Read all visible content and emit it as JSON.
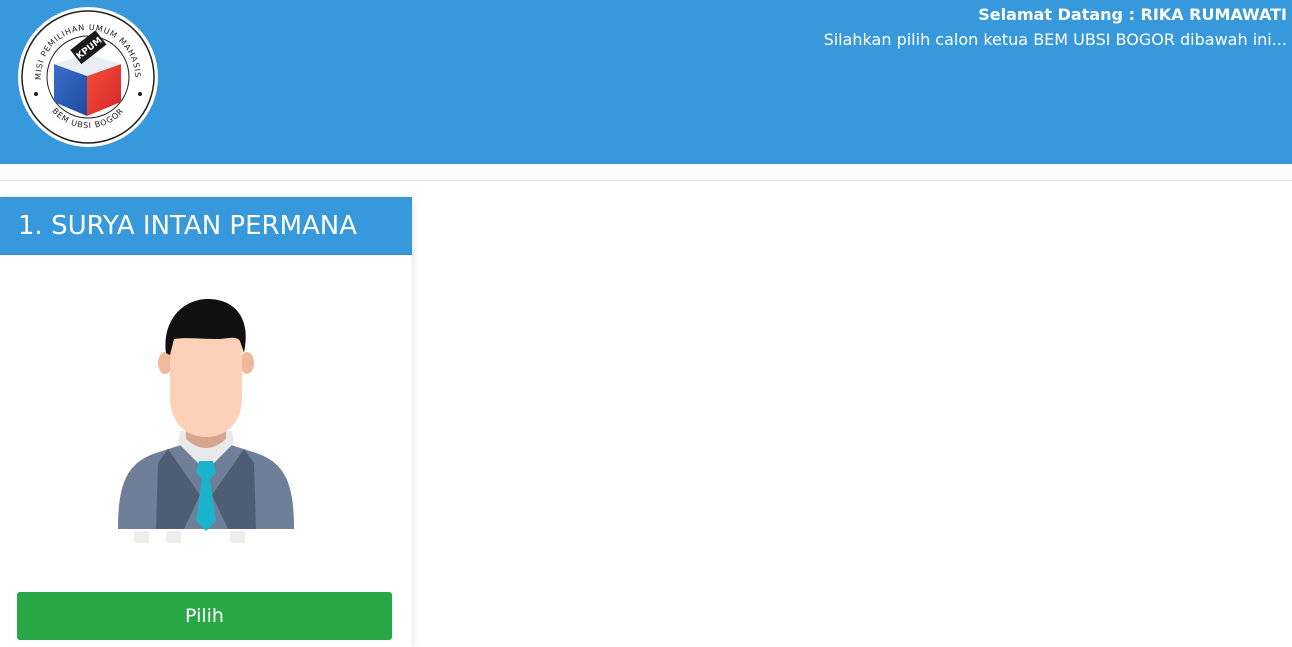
{
  "header": {
    "logo": {
      "ring_text_top": "KOMISI PEMILIHAN UMUM MAHASISWA",
      "ring_text_bottom": "BEM UBSI BOGOR",
      "badge_text": "KPUM"
    },
    "welcome_line": "Selamat Datang : RIKA RUMAWATI",
    "instruction_line": "Silahkan pilih calon ketua BEM UBSI BOGOR dibawah ini..."
  },
  "candidates": [
    {
      "title": "1. SURYA INTAN PERMANA",
      "photo_icon": "person-avatar-icon",
      "button_label": "Pilih"
    }
  ],
  "colors": {
    "primary_blue": "#3798db",
    "button_green": "#28a745",
    "logo_blue": "#2b5fb5",
    "logo_red": "#e83a2c",
    "tie_cyan": "#19b4cc",
    "suit_gray": "#6f7f99"
  }
}
